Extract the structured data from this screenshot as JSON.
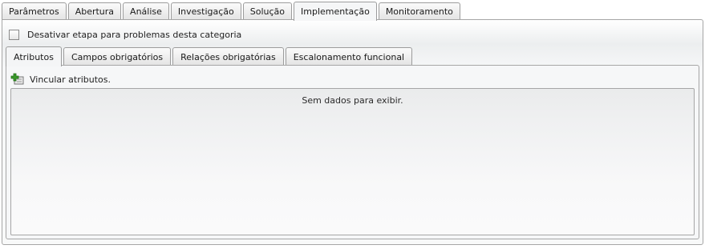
{
  "top_tabs": [
    {
      "label": "Parâmetros",
      "active": false
    },
    {
      "label": "Abertura",
      "active": false
    },
    {
      "label": "Análise",
      "active": false
    },
    {
      "label": "Investigação",
      "active": false
    },
    {
      "label": "Solução",
      "active": false
    },
    {
      "label": "Implementação",
      "active": true
    },
    {
      "label": "Monitoramento",
      "active": false
    }
  ],
  "disable_checkbox": {
    "label": "Desativar etapa para problemas desta categoria",
    "checked": false
  },
  "inner_tabs": [
    {
      "label": "Atributos",
      "active": true
    },
    {
      "label": "Campos obrigatórios",
      "active": false
    },
    {
      "label": "Relações obrigatórias",
      "active": false
    },
    {
      "label": "Escalonamento funcional",
      "active": false
    }
  ],
  "link_attributes": {
    "label": "Vincular atributos.",
    "icon": "add-link-icon"
  },
  "grid": {
    "empty_text": "Sem dados para exibir."
  },
  "colors": {
    "border": "#a6a6a6",
    "icon_green": "#3a9a2a"
  }
}
